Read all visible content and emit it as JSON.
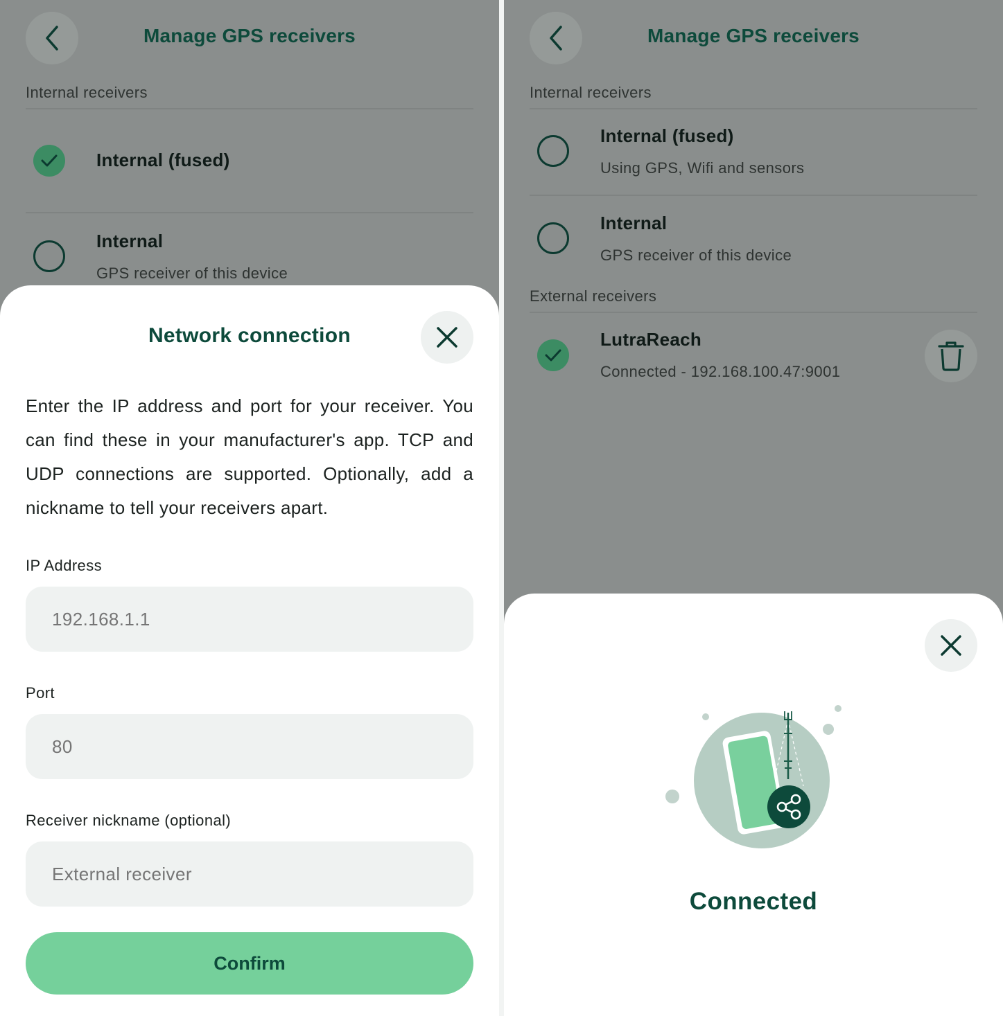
{
  "left_screen": {
    "header": {
      "title": "Manage GPS receivers"
    },
    "internal_section_label": "Internal receivers",
    "receivers": [
      {
        "name": "Internal (fused)",
        "subtitle": "",
        "selected": true
      },
      {
        "name": "Internal",
        "subtitle": "GPS receiver of this device",
        "selected": false
      }
    ],
    "sheet": {
      "title": "Network connection",
      "description": "Enter the IP address and port for your receiver. You can find these in your manufacturer's app. TCP and UDP connections are supported. Optionally, add a nickname to tell your receivers apart.",
      "ip_label": "IP Address",
      "ip_placeholder": "192.168.1.1",
      "port_label": "Port",
      "port_placeholder": "80",
      "nickname_label": "Receiver nickname (optional)",
      "nickname_placeholder": "External receiver",
      "confirm_label": "Confirm"
    }
  },
  "right_screen": {
    "header": {
      "title": "Manage GPS receivers"
    },
    "internal_section_label": "Internal receivers",
    "internal_receivers": [
      {
        "name": "Internal (fused)",
        "subtitle": "Using GPS, Wifi and sensors",
        "selected": false
      },
      {
        "name": "Internal",
        "subtitle": "GPS receiver of this device",
        "selected": false
      }
    ],
    "external_section_label": "External receivers",
    "external_receivers": [
      {
        "name": "LutraReach",
        "subtitle": "Connected - 192.168.100.47:9001",
        "selected": true
      }
    ],
    "sheet": {
      "status": "Connected"
    }
  },
  "colors": {
    "brand_dark": "#0d4a3b",
    "accent_green": "#75d09b",
    "check_green": "#3c8c63",
    "overlay_gray": "#8a8e8d",
    "field_bg": "#eff2f1"
  },
  "icons": [
    "chevron-left-icon",
    "check-icon",
    "close-icon",
    "trash-icon",
    "share-icon",
    "phone-icon",
    "antenna-icon"
  ]
}
